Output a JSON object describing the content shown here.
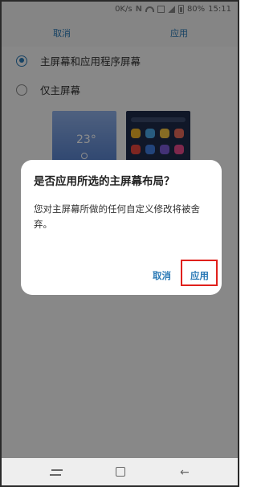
{
  "status_bar": {
    "speed": "0K/s",
    "nfc": "N",
    "battery_percent": "80%",
    "time": "15:11"
  },
  "action_bar": {
    "cancel_label": "取消",
    "apply_label": "应用"
  },
  "options": [
    {
      "label": "主屏幕和应用程序屏幕",
      "selected": true
    },
    {
      "label": "仅主屏幕",
      "selected": false
    }
  ],
  "preview": {
    "clock": "23°"
  },
  "dialog": {
    "title": "是否应用所选的主屏幕布局？",
    "message": "您对主屏幕所做的任何自定义修改将被舍弃。",
    "cancel_label": "取消",
    "apply_label": "应用"
  },
  "colors": {
    "accent": "#2b7ab6",
    "highlight": "#e0201c"
  },
  "icons": [
    "wifi-icon",
    "nfc-icon",
    "signal-icon",
    "image-icon",
    "battery-icon",
    "recent-apps-icon",
    "home-icon",
    "back-icon"
  ]
}
